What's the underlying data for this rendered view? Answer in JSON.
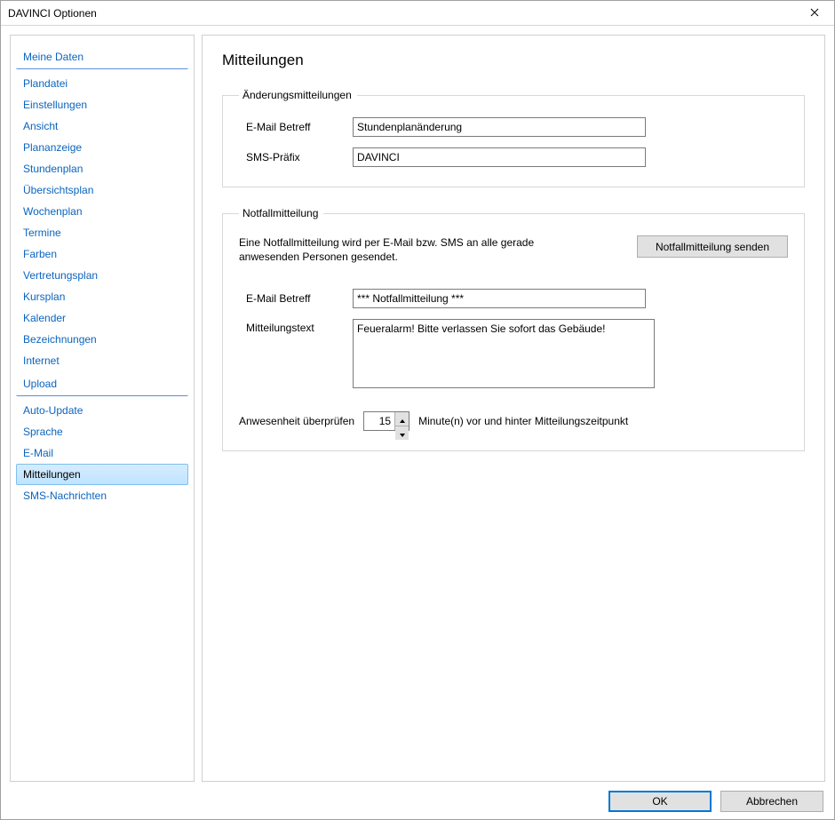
{
  "window": {
    "title": "DAVINCI Optionen"
  },
  "sidebar": {
    "groups": [
      {
        "header": "Meine Daten",
        "items": [
          "Plandatei",
          "Einstellungen",
          "Ansicht",
          "Plananzeige",
          "Stundenplan",
          "Übersichtsplan",
          "Wochenplan",
          "Termine",
          "Farben",
          "Vertretungsplan",
          "Kursplan",
          "Kalender",
          "Bezeichnungen",
          "Internet",
          "Upload"
        ]
      },
      {
        "header": null,
        "items": [
          "Auto-Update",
          "Sprache",
          "E-Mail",
          "Mitteilungen",
          "SMS-Nachrichten"
        ]
      }
    ],
    "selected": "Mitteilungen"
  },
  "page": {
    "title": "Mitteilungen",
    "change_group": {
      "legend": "Änderungsmitteilungen",
      "email_subject_label": "E-Mail Betreff",
      "email_subject_value": "Stundenplanänderung",
      "sms_prefix_label": "SMS-Präfix",
      "sms_prefix_value": "DAVINCI"
    },
    "emergency_group": {
      "legend": "Notfallmitteilung",
      "note": "Eine Notfallmitteilung wird per E-Mail bzw. SMS an alle gerade anwesenden Personen gesendet.",
      "send_button": "Notfallmitteilung senden",
      "email_subject_label": "E-Mail Betreff",
      "email_subject_value": "*** Notfallmitteilung ***",
      "message_label": "Mitteilungstext",
      "message_value": "Feueralarm! Bitte verlassen Sie sofort das Gebäude!",
      "attendance_label_before": "Anwesenheit überprüfen",
      "attendance_minutes": "15",
      "attendance_label_after": "Minute(n) vor und hinter Mitteilungszeitpunkt"
    }
  },
  "dialog": {
    "ok": "OK",
    "cancel": "Abbrechen"
  }
}
